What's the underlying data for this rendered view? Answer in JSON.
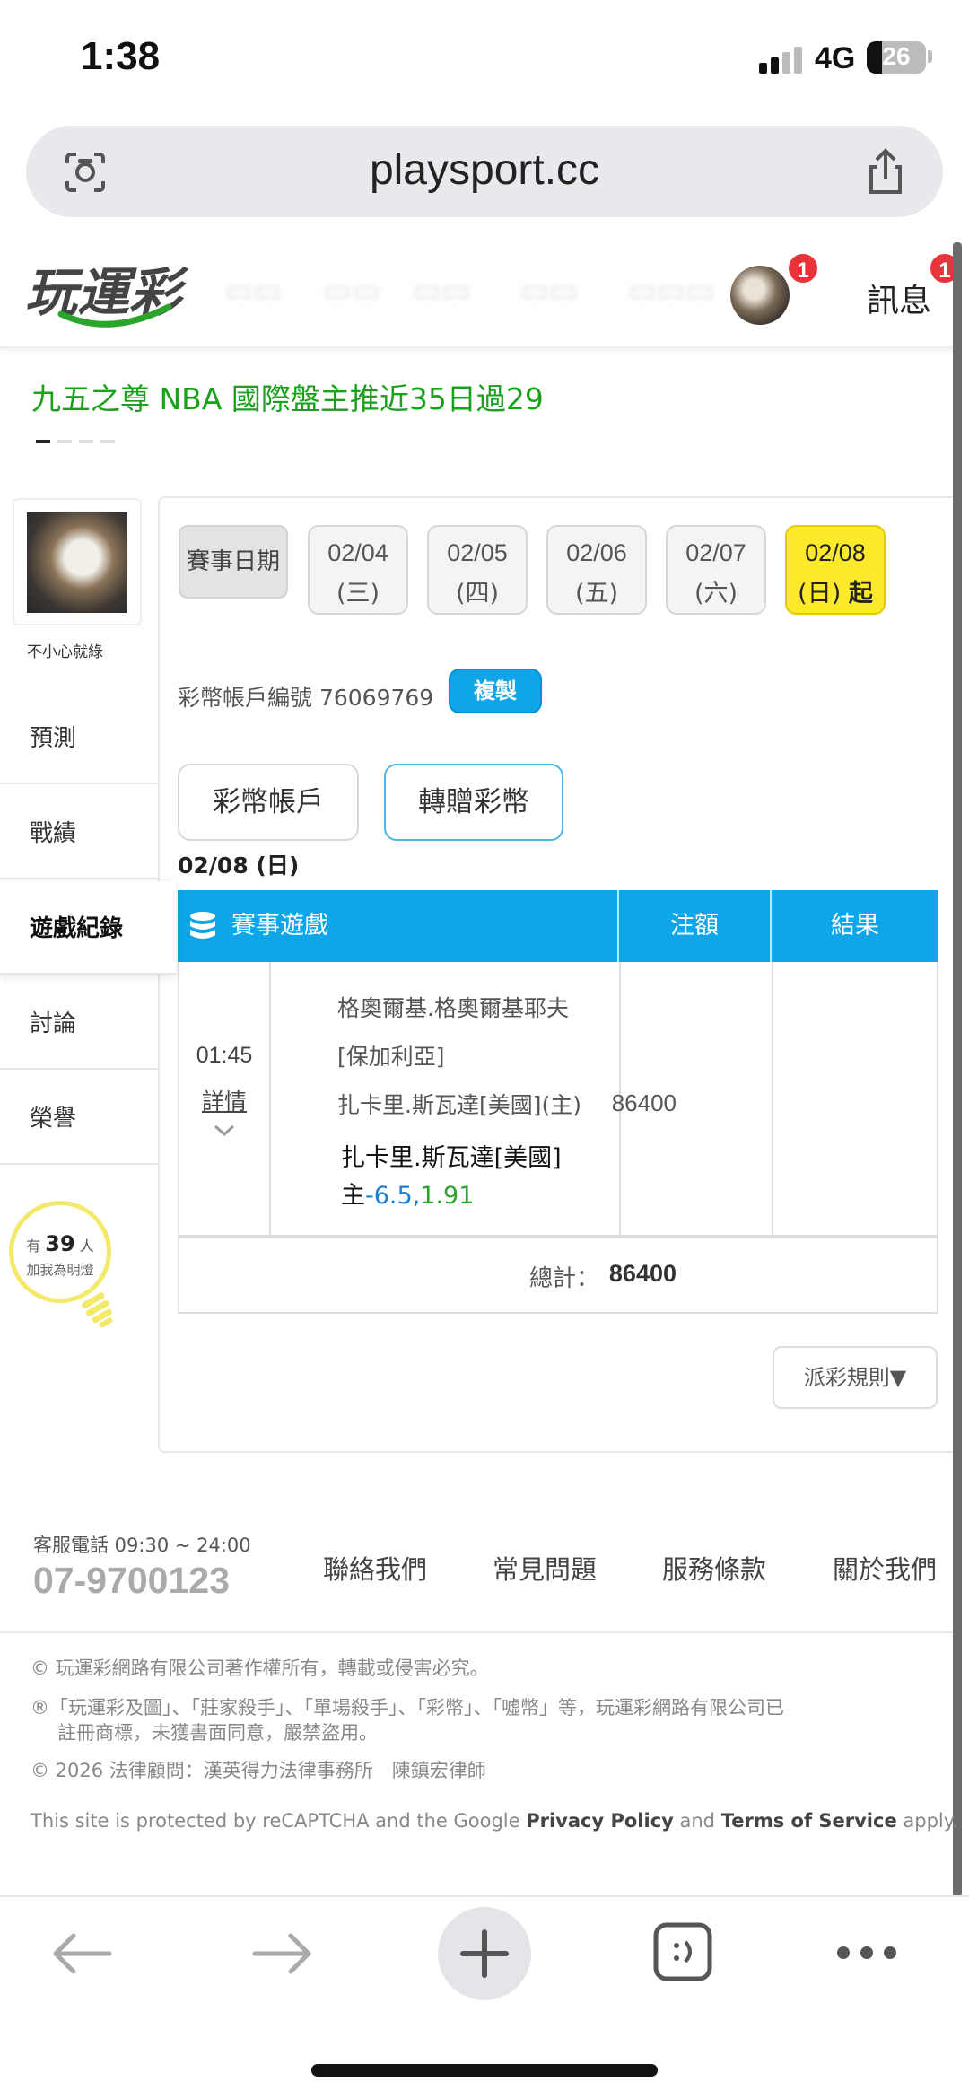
{
  "status_bar": {
    "time": "1:38",
    "network": "4G",
    "battery": "26",
    "battery_level": 0.26
  },
  "browser": {
    "url": "playsport.cc"
  },
  "header": {
    "logo": "玩運彩",
    "notif_badge": "1",
    "messages_label": "訊息",
    "messages_badge": "1"
  },
  "headline": "九五之尊 NBA 國際盤主推近35日過29",
  "sidebar": {
    "user_name": "不小心就綠",
    "items": [
      {
        "label": "預測"
      },
      {
        "label": "戰績"
      },
      {
        "label": "遊戲紀錄"
      },
      {
        "label": "討論"
      },
      {
        "label": "榮譽"
      }
    ],
    "fans_prefix": "有",
    "fans_count": "39",
    "fans_suffix": "人",
    "fans_cta": "加我為明燈"
  },
  "dates": {
    "label": "賽事日期",
    "items": [
      {
        "date": "02/04",
        "weekday": "(三)"
      },
      {
        "date": "02/05",
        "weekday": "(四)"
      },
      {
        "date": "02/06",
        "weekday": "(五)"
      },
      {
        "date": "02/07",
        "weekday": "(六)"
      },
      {
        "date": "02/08",
        "weekday": "(日)",
        "suffix": "起"
      }
    ]
  },
  "account": {
    "label": "彩幣帳戶編號 76069769",
    "copy": "複製"
  },
  "tabs": {
    "account": "彩幣帳戶",
    "gift": "轉贈彩幣"
  },
  "day_title": "02/08 (日)",
  "table": {
    "headers": {
      "game": "賽事遊戲",
      "stake": "注額",
      "result": "結果"
    },
    "row": {
      "time": "01:45",
      "detail": "詳情",
      "game_line1": "格奧爾基.格奧爾基耶夫",
      "game_line2": "[保加利亞]",
      "game_line3": "扎卡里.斯瓦達[美國](主)",
      "pick_team": "扎卡里.斯瓦達[美國]",
      "pick_side": "主",
      "pick_line": "-6.5",
      "pick_sep": ",",
      "pick_odds": "1.91",
      "stake": "86400",
      "result": ""
    },
    "total_label": "總計：",
    "total_value": "86400"
  },
  "rule_button": "派彩規則▼",
  "footer": {
    "phone_label": "客服電話 09:30 ~ 24:00",
    "phone": "07-9700123",
    "links": [
      "聯絡我們",
      "常見問題",
      "服務條款",
      "關於我們"
    ],
    "copyright": "© 玩運彩網路有限公司著作權所有，轉載或侵害必究。",
    "trademark_1": "®「玩運彩及圖」、「莊家殺手」、「單場殺手」、「彩幣」、「噓幣」等，玩運彩網路有限公司已",
    "trademark_2": "註冊商標，未獲書面同意，嚴禁盜用。",
    "legal": "© 2026 法律顧問：漢英得力法律事務所　陳鎮宏律師",
    "recaptcha_1": "This site is protected by reCAPTCHA and the Google ",
    "privacy": "Privacy Policy",
    "recaptcha_2": " and ",
    "terms": "Terms of Service",
    "recaptcha_3": " apply."
  }
}
